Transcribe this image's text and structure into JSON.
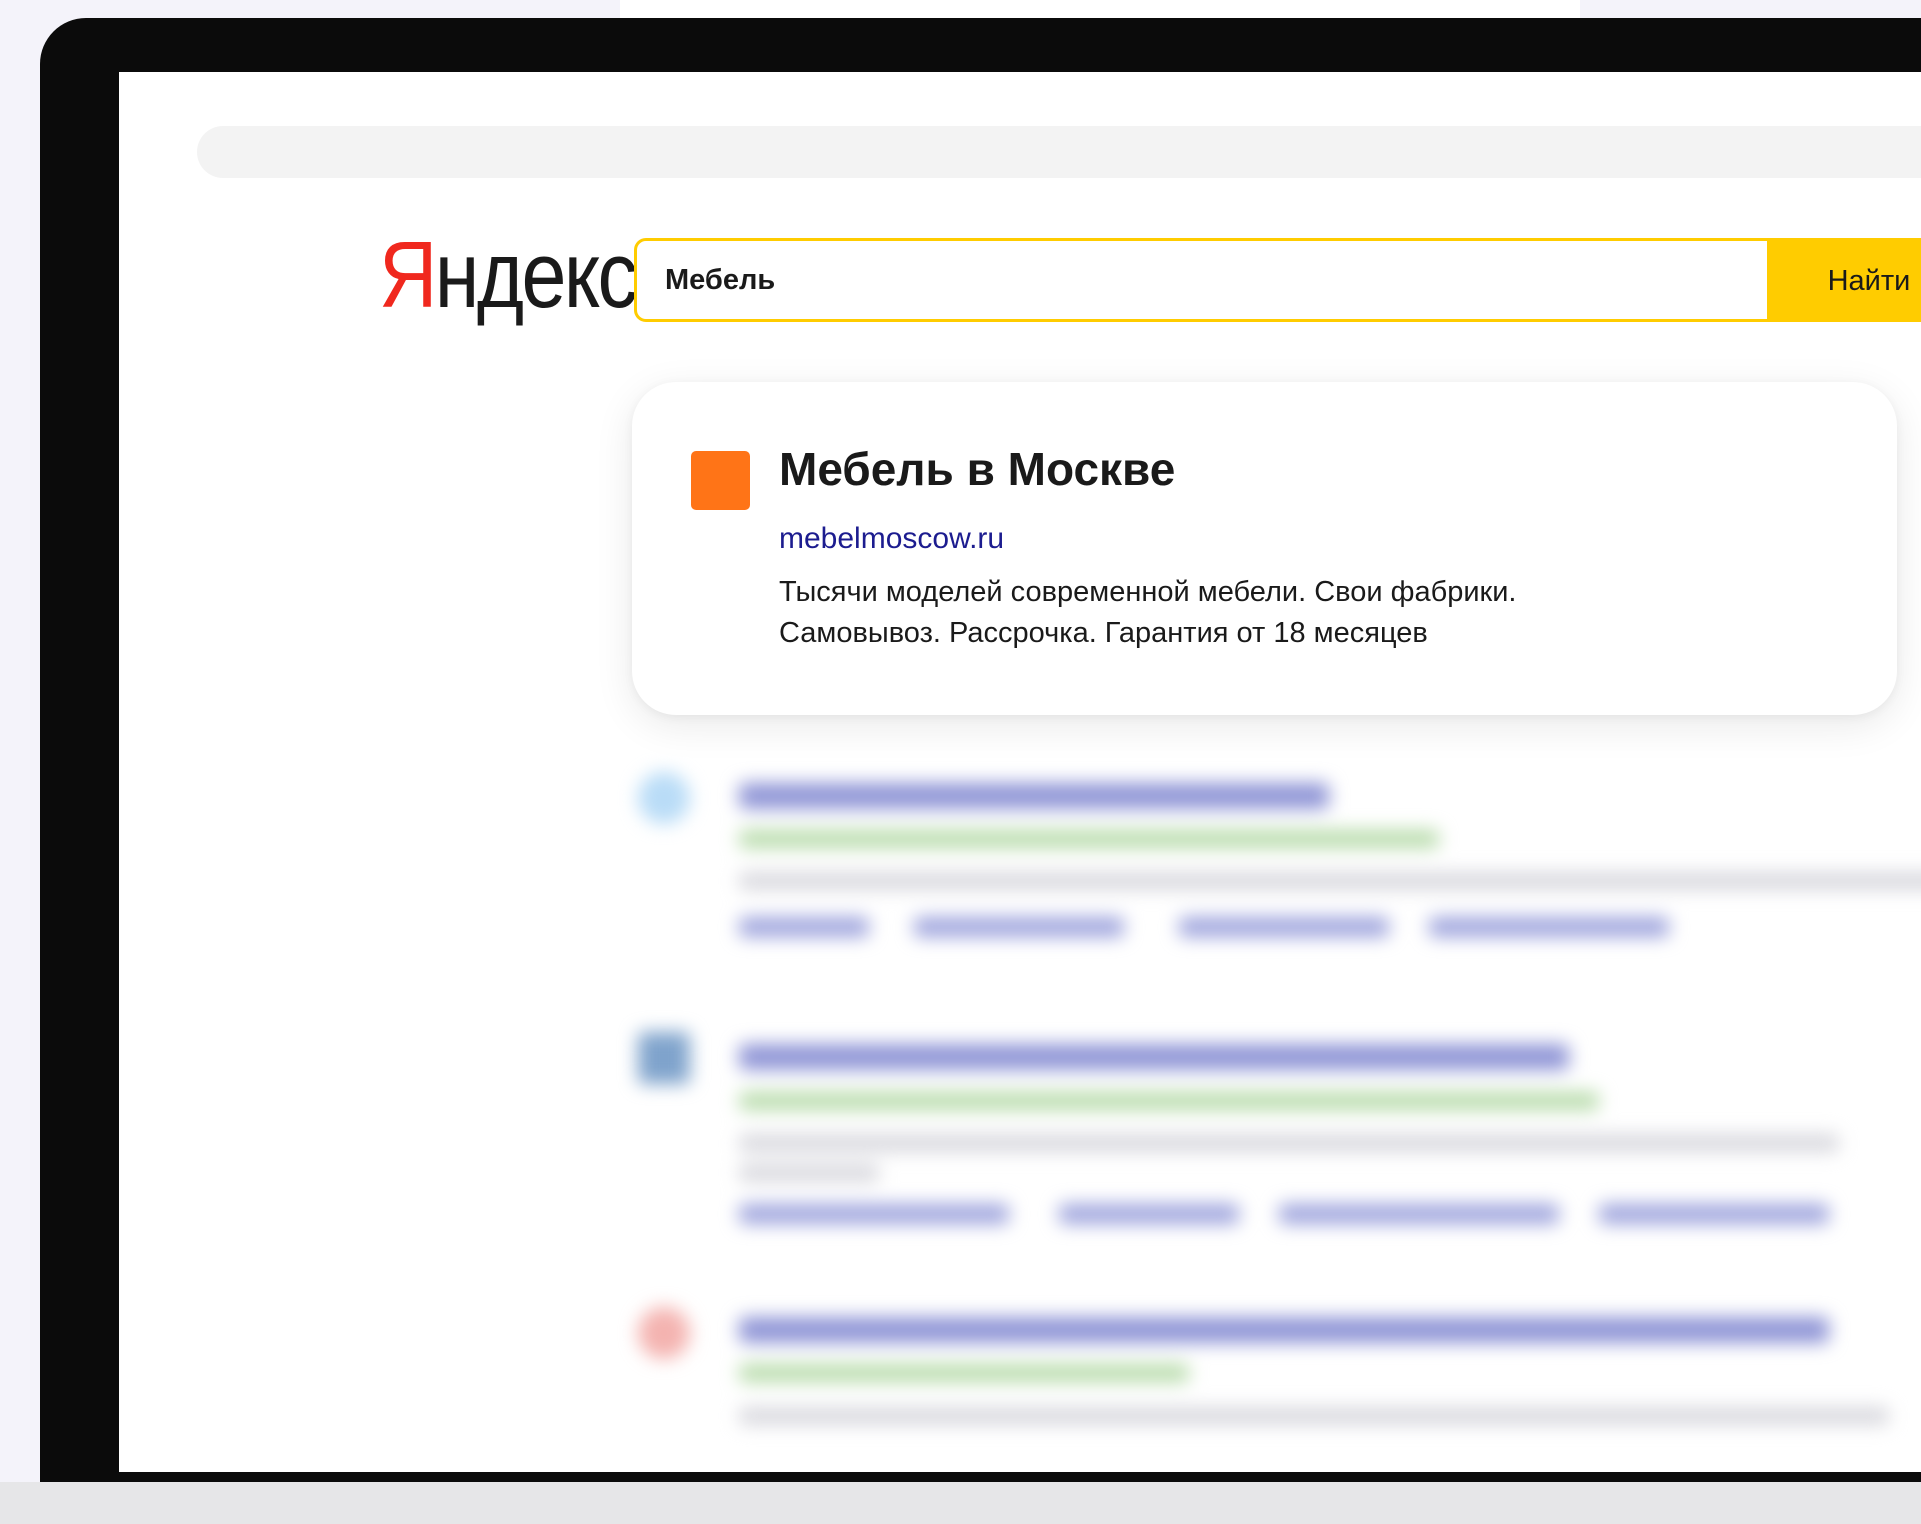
{
  "search": {
    "logo_first_letter": "Я",
    "logo_rest": "ндекс",
    "query": "Мебель",
    "button_label": "Найти"
  },
  "ad": {
    "title": "Мебель в Москве",
    "url": "mebelmoscow.ru",
    "description_line1": "Тысячи моделей современной мебели. Свои фабрики.",
    "description_line2": "Самовывоз. Рассрочка. Гарантия от 18 месяцев",
    "favicon_color": "#ff7417"
  },
  "colors": {
    "brand_yellow": "#ffcc00",
    "logo_red": "#f0281e",
    "link_blue": "#1c1c8f"
  }
}
